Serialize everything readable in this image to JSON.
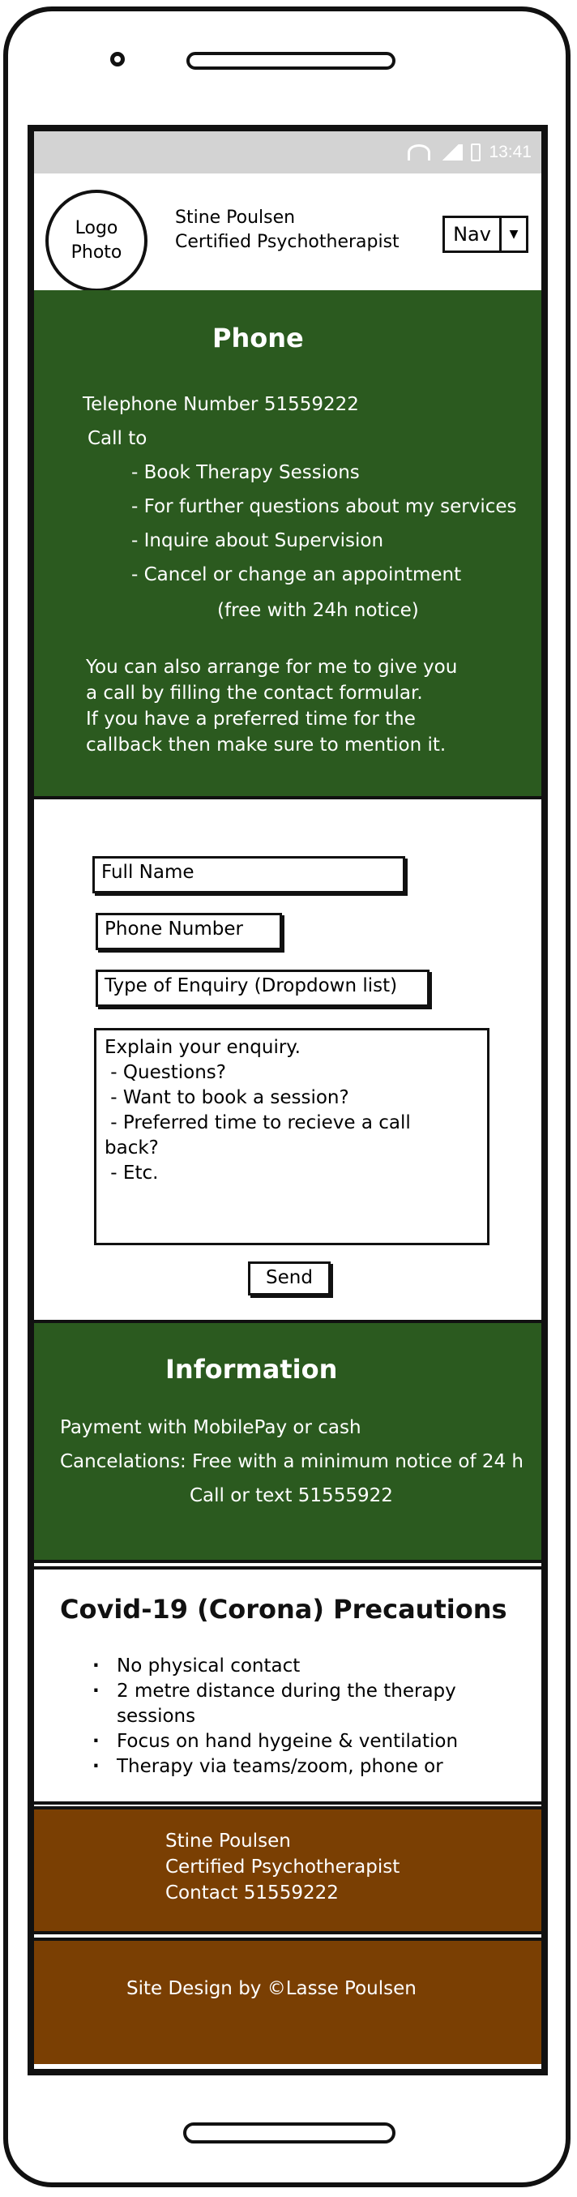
{
  "status": {
    "time": "13:41"
  },
  "header": {
    "logo_line1": "Logo",
    "logo_line2": "Photo",
    "name": "Stine Poulsen",
    "title": "Certified Psychotherapist",
    "nav_label": "Nav"
  },
  "phone_section": {
    "title": "Phone",
    "telephone": "Telephone Number 51559222",
    "call_to": "Call to",
    "items": [
      "- Book Therapy Sessions",
      "- For further questions about my services",
      "- Inquire about Supervision",
      "- Cancel or change an appointment"
    ],
    "notice": "(free with 24h notice)",
    "paragraph": [
      "You can also arrange for me to give you",
      "a call by filling the contact formular.",
      "If you have a preferred time for the",
      "callback then make sure to mention it."
    ]
  },
  "form": {
    "full_name": "Full Name",
    "phone_number": "Phone Number",
    "enquiry_type": "Type of Enquiry (Dropdown list)",
    "explain_lines": [
      "Explain your enquiry.",
      " - Questions?",
      " - Want to book a session?",
      " - Preferred time to recieve a call",
      "back?",
      " - Etc."
    ],
    "send_label": "Send"
  },
  "information": {
    "title": "Information",
    "payment": "Payment with MobilePay or cash",
    "cancelations": "Cancelations: Free with a minimum notice of 24 h",
    "call_text": "Call or text 51555922"
  },
  "covid": {
    "title": "Covid-19 (Corona) Precautions",
    "items": [
      "No physical contact",
      "2 metre distance during the therapy sessions",
      "Focus on hand hygeine & ventilation",
      "Therapy via teams/zoom, phone or"
    ]
  },
  "footer": {
    "name": "Stine Poulsen",
    "title": "Certified Psychotherapist",
    "contact": "Contact 51559222",
    "credit": "Site Design by ©Lasse Poulsen"
  },
  "colors": {
    "green": "#2b5a1f",
    "brown": "#7a3f03",
    "statusbar": "#d3d3d3"
  }
}
